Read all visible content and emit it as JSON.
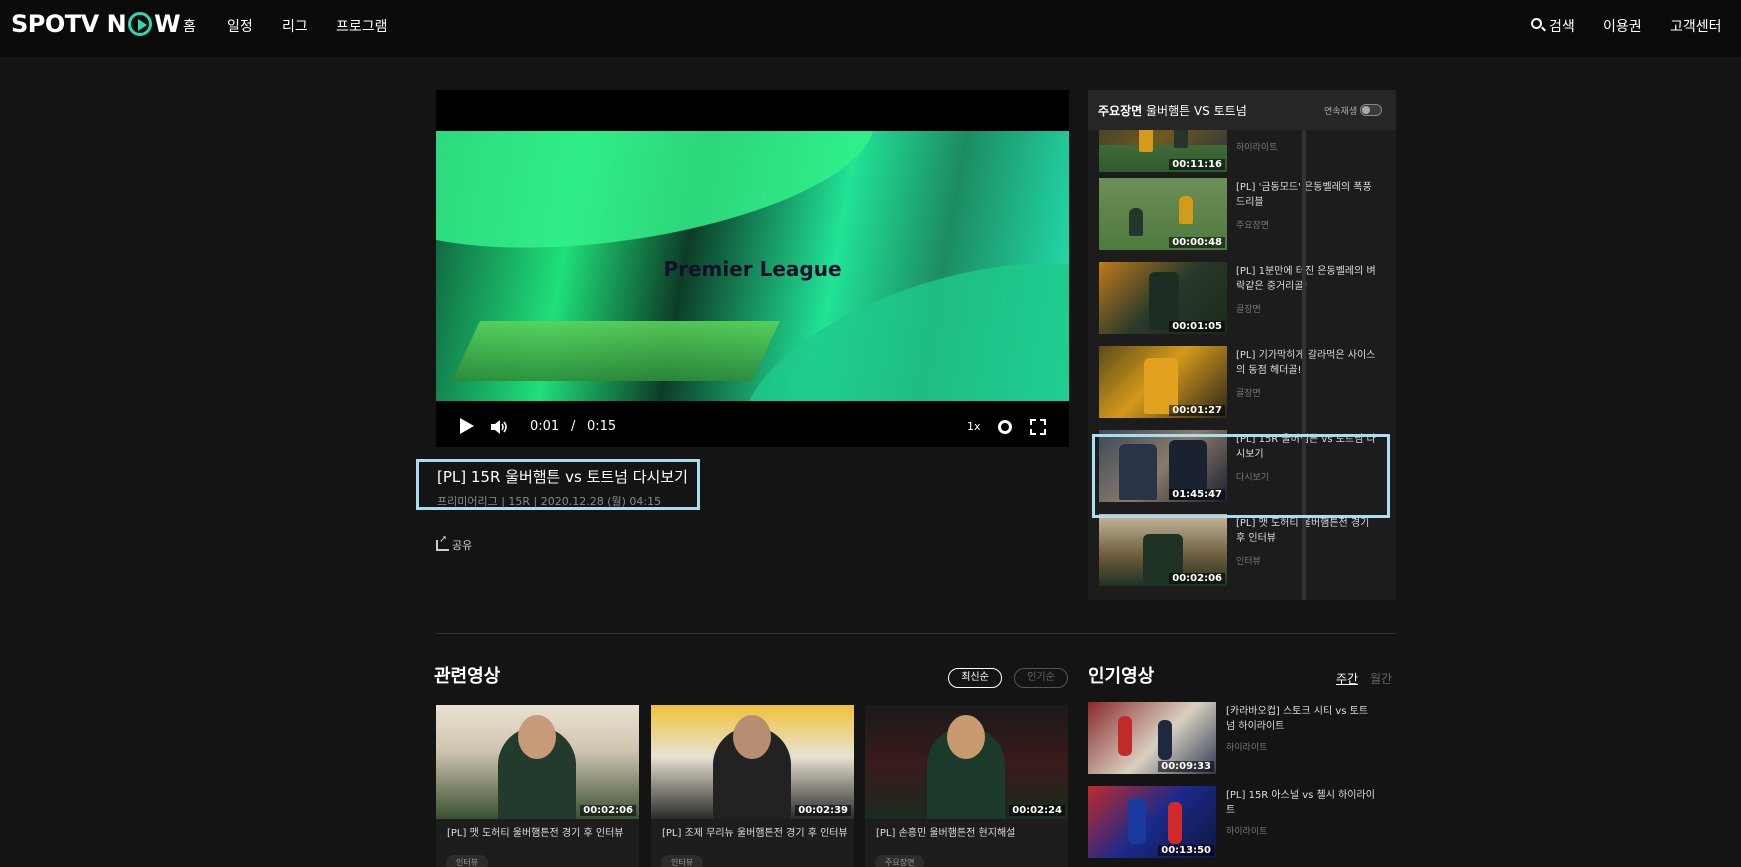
{
  "header": {
    "logo": "SPOTV NOW",
    "logo_left": "SPOTV N",
    "logo_right": "W",
    "nav": [
      "홈",
      "일정",
      "리그",
      "프로그램"
    ],
    "search_label": "검색",
    "pass_label": "이용권",
    "support_label": "고객센터"
  },
  "player": {
    "overlay_text": "Premier League",
    "current_time": "0:01",
    "separator": "/",
    "duration": "0:15",
    "speed": "1x"
  },
  "video": {
    "title": "[PL] 15R 울버햄튼 vs 토트넘 다시보기",
    "meta": "프리미어리그 | 15R | 2020.12.28 (월) 04:15",
    "share_label": "공유"
  },
  "highlights": {
    "label": "주요장면",
    "match": "울버햄튼 VS 토트넘",
    "autoplay_label": "연속재생",
    "items": [
      {
        "title": "",
        "category": "하이라이트",
        "duration": "00:11:16"
      },
      {
        "title": "[PL] '금동모드' 은동벨레의 폭풍 드리블",
        "category": "주요장면",
        "duration": "00:00:48"
      },
      {
        "title": "[PL] 1분만에 터진 은동벨레의 벼락같은 중거리골!",
        "category": "골장면",
        "duration": "00:01:05"
      },
      {
        "title": "[PL] 기가막히게 갈라먹은 사이스의 동점 헤더골!",
        "category": "골장면",
        "duration": "00:01:27"
      },
      {
        "title": "[PL] 15R 울버햄튼 vs 토트넘 다시보기",
        "category": "다시보기",
        "duration": "01:45:47"
      },
      {
        "title": "[PL] 맷 도허티 울버햄튼전 경기 후 인터뷰",
        "category": "인터뷰",
        "duration": "00:02:06"
      }
    ]
  },
  "related": {
    "title": "관련영상",
    "sort_latest": "최신순",
    "sort_popular": "인기순",
    "items": [
      {
        "title": "[PL] 맷 도허티 울버햄튼전 경기 후 인터뷰",
        "duration": "00:02:06",
        "tag": "인터뷰"
      },
      {
        "title": "[PL] 조제 무리뉴 울버햄튼전 경기 후 인터뷰",
        "duration": "00:02:39",
        "tag": "인터뷰"
      },
      {
        "title": "[PL] 손흥민 울버햄튼전 현지해설",
        "duration": "00:02:24",
        "tag": "주요장면"
      }
    ]
  },
  "popular": {
    "title": "인기영상",
    "tab_weekly": "주간",
    "tab_monthly": "월간",
    "items": [
      {
        "title": "[카라바오컵] 스토크 시티 vs 토트넘 하이라이트",
        "category": "하이라이트",
        "duration": "00:09:33"
      },
      {
        "title": "[PL] 15R 아스널 vs 첼시 하이라이트",
        "category": "하이라이트",
        "duration": "00:13:50"
      }
    ]
  },
  "colors": {
    "accent": "#2fd6b2",
    "highlight_border": "#a8def0",
    "background": "#141414"
  }
}
